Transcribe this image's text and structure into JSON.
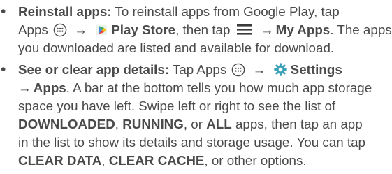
{
  "bullet_char": "•",
  "arrow": "→",
  "items": [
    {
      "title": "Reinstall apps:",
      "l1_text": " To reinstall apps from Google Play, tap",
      "l2_apps": "Apps",
      "l2_play_store": "Play Store",
      "l2_then_tap": ", then tap",
      "l2_my_apps": "My Apps",
      "l2_tail": ". The apps",
      "l3": "you downloaded are listed and available for download."
    },
    {
      "title": "See or clear app details:",
      "l1_tap_apps": " Tap Apps",
      "l1_settings": "Settings",
      "l2_apps": "Apps",
      "l2_tail": ". A bar at the bottom tells you how much app storage",
      "l3": "space you have left. Swipe left or right to see the list of",
      "l4_downloaded": "DOWNLOADED",
      "l4_sep1": ", ",
      "l4_running": "RUNNING",
      "l4_sep2": ", or ",
      "l4_all": "ALL",
      "l4_tail": " apps, then tap an app",
      "l5": "in the list to show its details and storage usage. You can tap",
      "l6_clear_data": "CLEAR DATA",
      "l6_sep1": ", ",
      "l6_clear_cache": "CLEAR CACHE",
      "l6_tail": ", or other options."
    }
  ],
  "icons": {
    "apps": "apps-icon",
    "play_store": "play-store-icon",
    "menu": "menu-icon",
    "settings": "settings-gear-icon"
  },
  "colors": {
    "text": "#4a4a4a",
    "gear": "#3aa0b8",
    "store_green": "#34a853",
    "store_blue": "#4285f4",
    "store_red": "#ea4335",
    "store_yellow": "#fbbc05"
  }
}
